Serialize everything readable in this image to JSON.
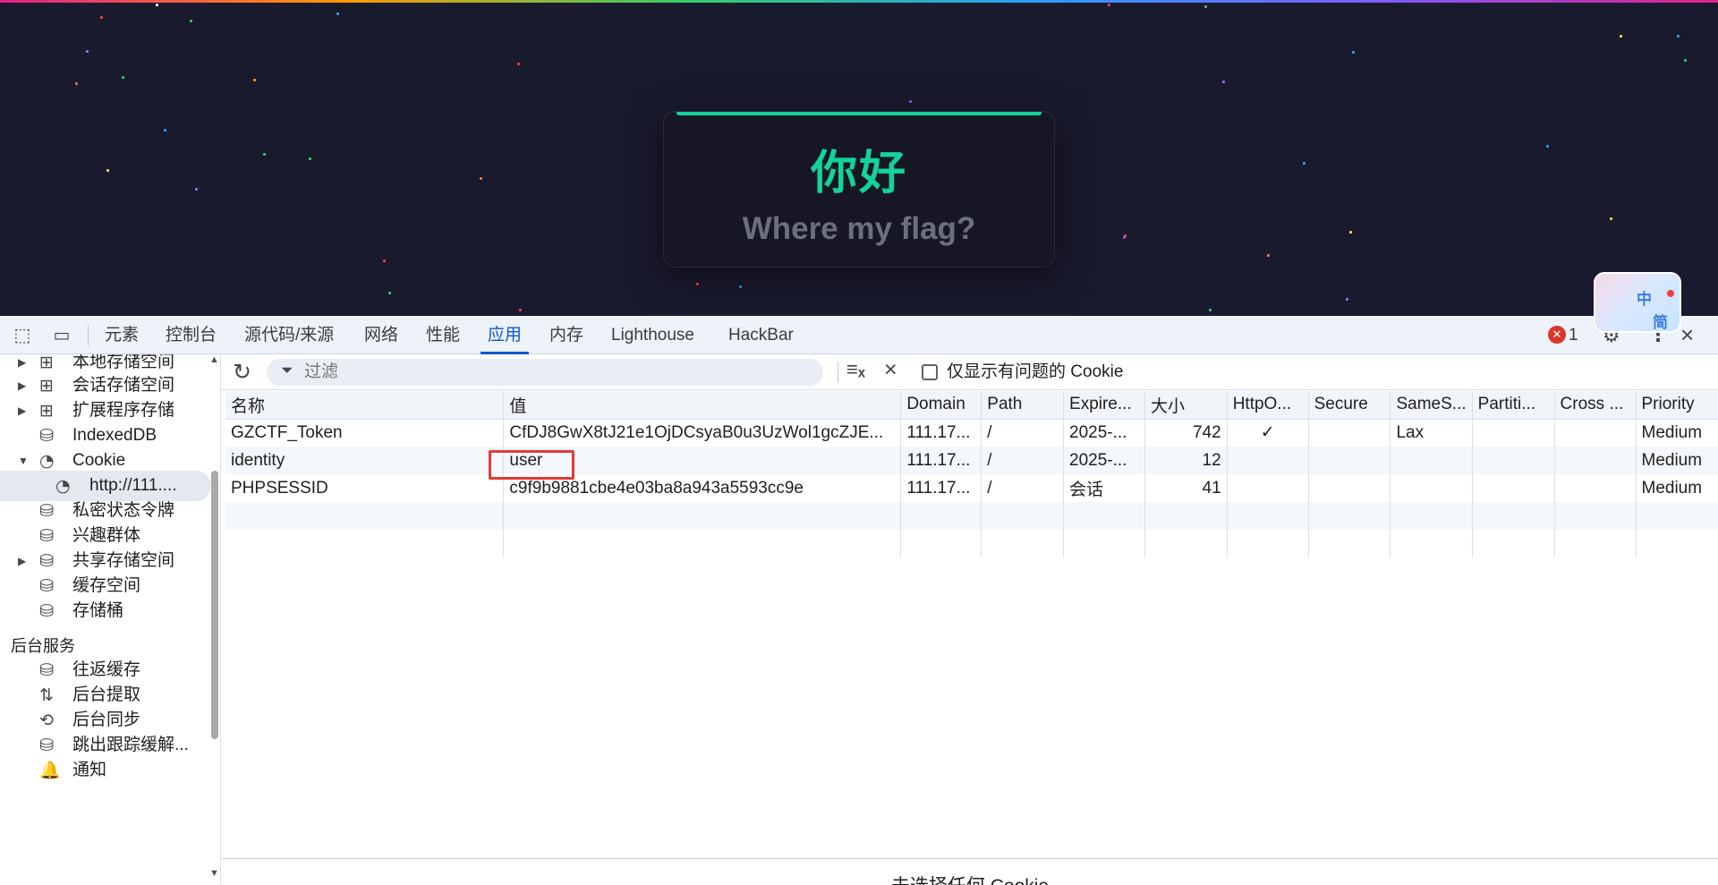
{
  "page": {
    "title": "你好",
    "subtitle": "Where my flag?"
  },
  "translate_widget": {
    "top_char": "中",
    "bottom_char": "简"
  },
  "devtools": {
    "tabs": [
      "元素",
      "控制台",
      "源代码/来源",
      "网络",
      "性能",
      "应用",
      "内存",
      "Lighthouse",
      "HackBar"
    ],
    "active_tab": "应用",
    "error_count": "1",
    "error_icon": "✕"
  },
  "sidebar": {
    "items": [
      {
        "label": "本地存储空间",
        "icon": "table-icon",
        "arrow": "▶"
      },
      {
        "label": "会话存储空间",
        "icon": "table-icon",
        "arrow": "▶"
      },
      {
        "label": "扩展程序存储",
        "icon": "table-icon",
        "arrow": "▶"
      },
      {
        "label": "IndexedDB",
        "icon": "database-icon",
        "arrow": ""
      },
      {
        "label": "Cookie",
        "icon": "cookie-icon",
        "arrow": "▼"
      },
      {
        "label": "http://111....",
        "icon": "cookie-icon",
        "arrow": ""
      },
      {
        "label": "私密状态令牌",
        "icon": "database-icon",
        "arrow": ""
      },
      {
        "label": "兴趣群体",
        "icon": "database-icon",
        "arrow": ""
      },
      {
        "label": "共享存储空间",
        "icon": "database-icon",
        "arrow": "▶"
      },
      {
        "label": "缓存空间",
        "icon": "database-icon",
        "arrow": ""
      },
      {
        "label": "存储桶",
        "icon": "database-icon",
        "arrow": ""
      }
    ],
    "section_heading": "后台服务",
    "services": [
      {
        "label": "往返缓存",
        "icon": "database-icon"
      },
      {
        "label": "后台提取",
        "icon": "fetch-arrows-icon"
      },
      {
        "label": "后台同步",
        "icon": "sync-icon"
      },
      {
        "label": "跳出跟踪缓解...",
        "icon": "database-icon"
      },
      {
        "label": "通知",
        "icon": "bell-icon"
      }
    ]
  },
  "toolbar": {
    "filter_placeholder": "过滤",
    "only_issues_label": "仅显示有问题的 Cookie"
  },
  "cookie_table": {
    "columns": [
      "名称",
      "值",
      "Domain",
      "Path",
      "Expire...",
      "大小",
      "HttpO...",
      "Secure",
      "SameS...",
      "Partiti...",
      "Cross ...",
      "Priority"
    ],
    "rows": [
      {
        "name": "GZCTF_Token",
        "value": "CfDJ8GwX8tJ21e1OjDCsyaB0u3UzWol1gcZJE...",
        "domain": "111.17...",
        "path": "/",
        "expires": "2025-...",
        "size": "742",
        "httponly": "✓",
        "secure": "",
        "samesite": "Lax",
        "partition": "",
        "cross": "",
        "priority": "Medium"
      },
      {
        "name": "identity",
        "value": "user",
        "domain": "111.17...",
        "path": "/",
        "expires": "2025-...",
        "size": "12",
        "httponly": "",
        "secure": "",
        "samesite": "",
        "partition": "",
        "cross": "",
        "priority": "Medium"
      },
      {
        "name": "PHPSESSID",
        "value": "c9f9b9881cbe4e03ba8a943a5593cc9e",
        "domain": "111.17...",
        "path": "/",
        "expires": "会话",
        "size": "41",
        "httponly": "",
        "secure": "",
        "samesite": "",
        "partition": "",
        "cross": "",
        "priority": "Medium"
      }
    ]
  },
  "detail_pane": {
    "message": "未选择任何 Cookie"
  },
  "colors": {
    "accent": "#13d39a",
    "devtools_active": "#0b57d0",
    "highlight": "#e53935"
  }
}
